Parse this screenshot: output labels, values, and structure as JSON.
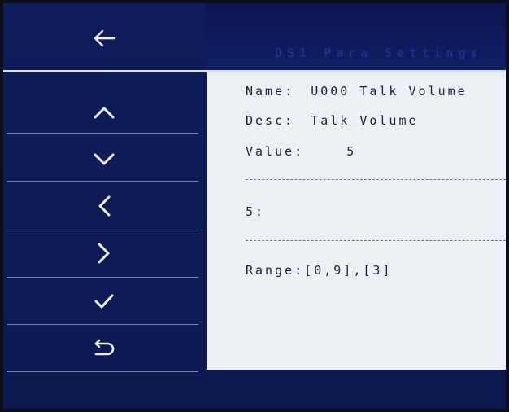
{
  "header": {
    "title": "DS1 Para Settings"
  },
  "sidebar": {
    "buttons": [
      {
        "icon": "back-arrow-icon",
        "action": "back"
      },
      {
        "icon": "chevron-up-icon",
        "action": "up"
      },
      {
        "icon": "chevron-down-icon",
        "action": "down"
      },
      {
        "icon": "chevron-left-icon",
        "action": "left"
      },
      {
        "icon": "chevron-right-icon",
        "action": "right"
      },
      {
        "icon": "check-icon",
        "action": "confirm"
      },
      {
        "icon": "return-icon",
        "action": "return"
      }
    ]
  },
  "param": {
    "name_label": "Name:",
    "name_value": "U000 Talk Volume",
    "desc_label": "Desc:",
    "desc_value": "Talk Volume",
    "value_label": "Value:",
    "value": "5",
    "edit_line": "5:",
    "range_text": "Range:[0,9],[3]"
  },
  "colors": {
    "sidebar_bg": "#0d1a52",
    "content_bg": "#eceff3",
    "text": "#1b2133",
    "icon": "#eef1ff"
  }
}
